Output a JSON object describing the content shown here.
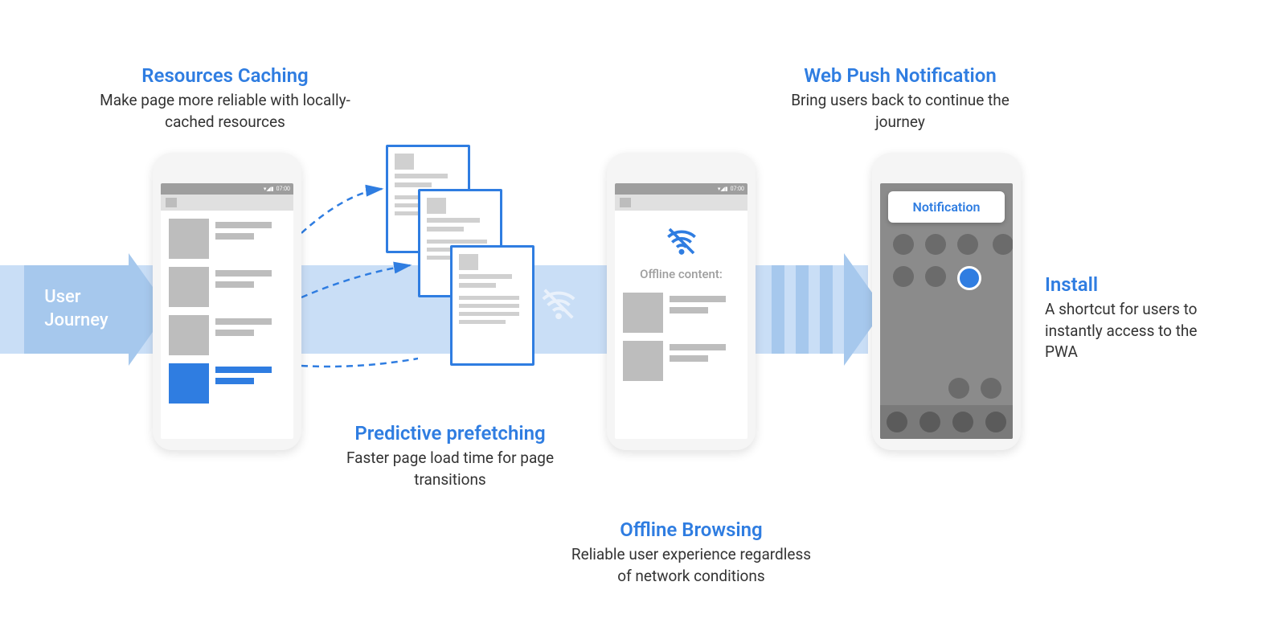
{
  "journey": {
    "label": "User\nJourney"
  },
  "labels": {
    "caching": {
      "title": "Resources Caching",
      "desc": "Make page more reliable with locally-cached resources"
    },
    "prefetch": {
      "title": "Predictive prefetching",
      "desc": "Faster page load time for page transitions"
    },
    "offline": {
      "title": "Offline Browsing",
      "desc": "Reliable user experience regardless of network conditions"
    },
    "push": {
      "title": "Web Push Notification",
      "desc": "Bring users back to continue the journey"
    },
    "install": {
      "title": "Install",
      "desc": "A shortcut for users to instantly access to the PWA"
    }
  },
  "phone2": {
    "offline_text": "Offline content:"
  },
  "phone3": {
    "notification": "Notification"
  },
  "statusbar": {
    "time": "07:00"
  }
}
